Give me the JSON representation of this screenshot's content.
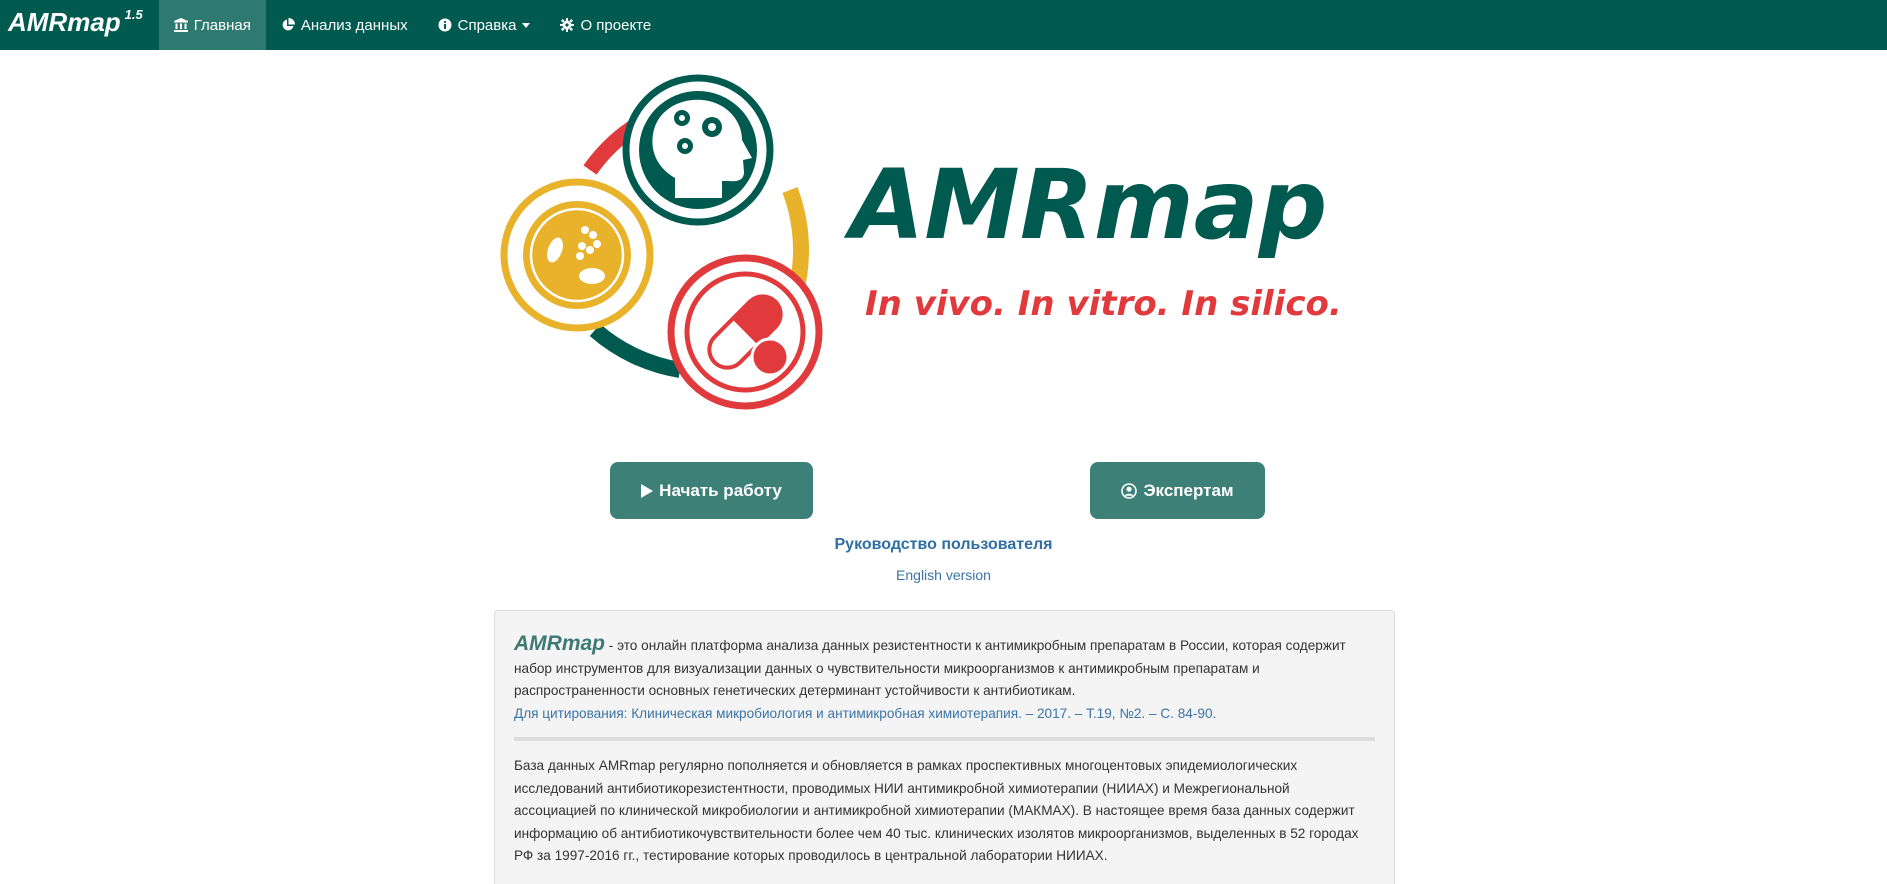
{
  "navbar": {
    "brand": "AMRmap",
    "version": "1.5",
    "items": [
      {
        "label": "Главная",
        "icon": "institution-icon",
        "active": true
      },
      {
        "label": "Анализ данных",
        "icon": "pie-chart-icon"
      },
      {
        "label": "Справка",
        "icon": "info-circle-icon",
        "dropdown": true
      },
      {
        "label": "О проекте",
        "icon": "gear-icon"
      }
    ]
  },
  "logo": {
    "title": "AMRmap",
    "tagline": "In vivo. In vitro. In silico.",
    "colors": {
      "green": "#005a50",
      "red": "#e03a3c",
      "yellow": "#e8b22a"
    }
  },
  "actions": {
    "start_label": "Начать работу",
    "expert_label": "Экспертам",
    "guide_label": "Руководство пользователя",
    "english_label": "English version"
  },
  "info": {
    "name": "AMRmap",
    "intro": " - это онлайн платформа анализа данных резистентности к антимикробным препаратам в России, которая содержит набор инструментов для визуализации данных о чувствительности микроорганизмов к антимикробным препаратам и распространенности основных генетических детерминант устойчивости к антибиотикам.",
    "citation": "Для цитирования: Клиническая микробиология и антимикробная химиотерапия. – 2017. – Т.19, №2. – С. 84-90.",
    "database_text": "База данных AMRmap регулярно пополняется и обновляется в рамках проспективных многоцентовых эпидемиологических исследований антибиотикорезистентности, проводимых НИИ антимикробной химиотерапии (НИИАХ) и Межрегиональной ассоциацией по клинической микробиологии и антимикробной химиотерапии (МАКМАХ). В настоящее время база данных содержит информацию об антибиотикочувствительности более чем 40 тыс. клинических изолятов микроорганизмов, выделенных в 52 городах РФ за 1997-2016 гг., тестирование которых проводилось в центральной лаборатории НИИАХ."
  }
}
